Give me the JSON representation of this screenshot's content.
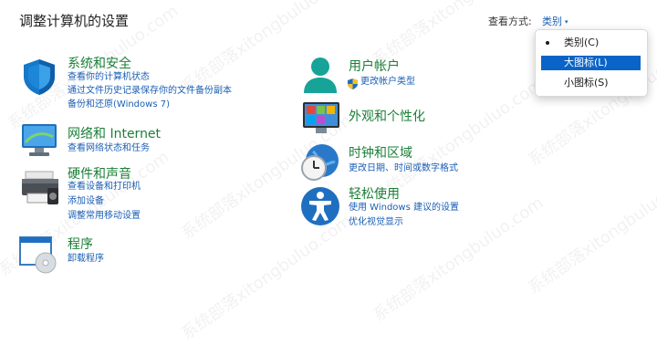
{
  "header": {
    "title": "调整计算机的设置",
    "view_by_label": "查看方式:",
    "view_by_value": "类别"
  },
  "view_menu": {
    "items": [
      {
        "label": "类别(C)",
        "checked": true
      },
      {
        "label": "大图标(L)",
        "highlighted": true
      },
      {
        "label": "小图标(S)"
      }
    ]
  },
  "categories": {
    "system": {
      "title": "系统和安全",
      "icon": "shield-icon",
      "links": [
        "查看你的计算机状态",
        "通过文件历史记录保存你的文件备份副本",
        "备份和还原(Windows 7)"
      ]
    },
    "network": {
      "title": "网络和 Internet",
      "icon": "network-monitor-icon",
      "links": [
        "查看网络状态和任务"
      ]
    },
    "hardware": {
      "title": "硬件和声音",
      "icon": "printer-icon",
      "links": [
        "查看设备和打印机",
        "添加设备",
        "调整常用移动设置"
      ]
    },
    "programs": {
      "title": "程序",
      "icon": "programs-disc-icon",
      "links": [
        "卸载程序"
      ]
    },
    "users": {
      "title": "用户帐户",
      "icon": "user-icon",
      "links": [
        "更改帐户类型"
      ]
    },
    "appearance": {
      "title": "外观和个性化",
      "icon": "appearance-icon",
      "links": []
    },
    "clock": {
      "title": "时钟和区域",
      "icon": "clock-globe-icon",
      "links": [
        "更改日期、时间或数字格式"
      ]
    },
    "ease": {
      "title": "轻松使用",
      "icon": "accessibility-icon",
      "links": [
        "使用 Windows 建议的设置",
        "优化视觉显示"
      ]
    }
  },
  "colors": {
    "category_title": "#1a7f37",
    "link": "#1a5fb4",
    "menu_highlight": "#0a64c8"
  },
  "watermark": "系统部落xitongbuluo.com"
}
